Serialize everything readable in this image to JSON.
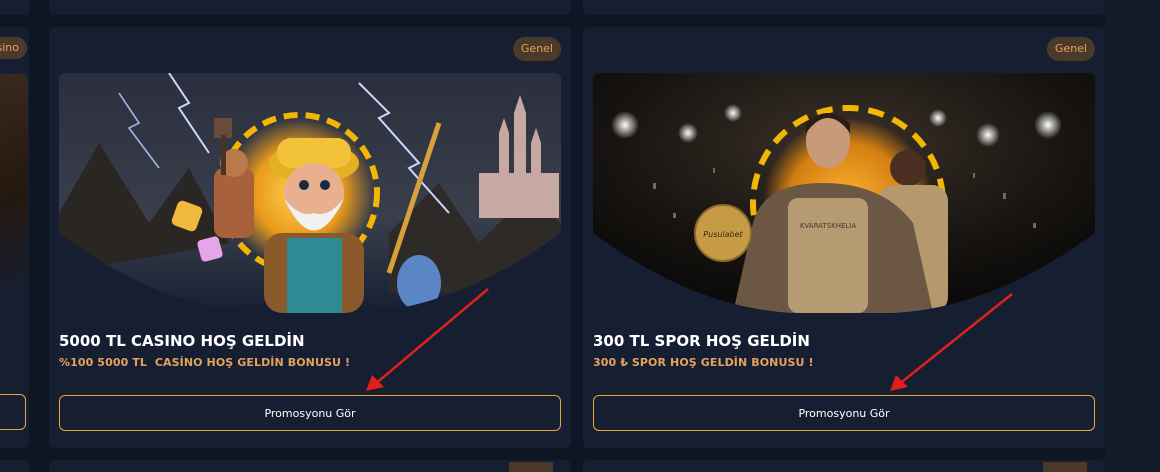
{
  "left_card": {
    "badge": "asino"
  },
  "promos": [
    {
      "badge": "Genel",
      "title": "5000 TL CASINO HOŞ GELDİN",
      "subtitle": "%100 5000 TL  CASİNO HOŞ GELDİN BONUSU !",
      "button_label": "Promosyonu Gör"
    },
    {
      "badge": "Genel",
      "title": "300 TL SPOR HOŞ GELDİN",
      "subtitle": "300 ₺ SPOR HOŞ GELDİN BONUSU !",
      "button_label": "Promosyonu Gör",
      "ball_text": "Pusulabet",
      "jersey_text": "KVARATSKHELIA"
    }
  ],
  "colors": {
    "background": "#0e1523",
    "card": "#161f32",
    "accent": "#e8a53c",
    "badge_bg": "#4b3a2a",
    "badge_text": "#e3a35c",
    "arrow": "#e0201b"
  },
  "icons": {
    "arrow": "red-annotation-arrow"
  }
}
